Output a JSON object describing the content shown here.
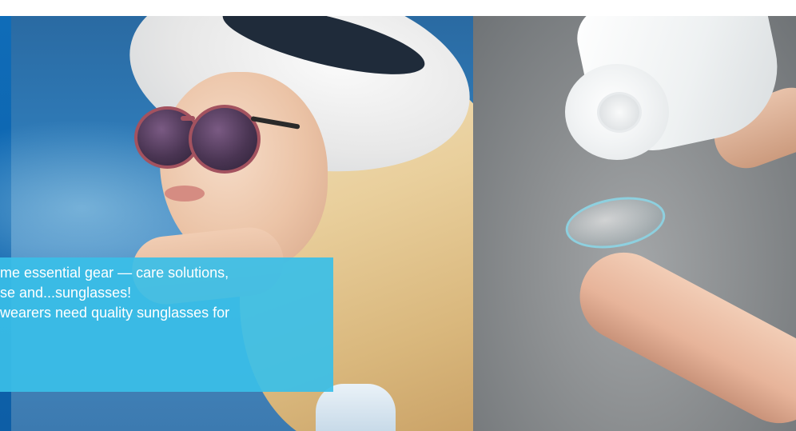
{
  "caption": {
    "lines": [
      "me essential gear — care solutions,",
      "se and...sunglasses!",
      "wearers need quality sunglasses for"
    ]
  },
  "images": {
    "left": {
      "icon": "woman-with-sunglasses-photo"
    },
    "right": {
      "icon": "contact-lens-on-finger-photo"
    }
  },
  "colors": {
    "caption_bg": "#3ABFE8",
    "accent_strip": "#0F6CB8",
    "caption_text": "#FFFFFF"
  }
}
